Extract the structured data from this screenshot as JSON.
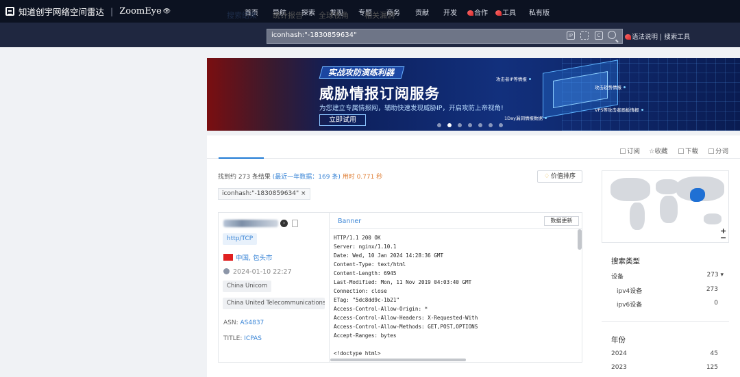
{
  "logo": {
    "cn": "知道创宇网络空间雷达",
    "sep": "|",
    "brand": "ZoomEye",
    "eye": "👁"
  },
  "nav": [
    "首页",
    "导航",
    "探索",
    "发现",
    "专题",
    "商务",
    "贡献",
    "开发",
    "合作",
    "工具",
    "私有版"
  ],
  "search": {
    "query": "iconhash:\"-1830859634\"",
    "icons": [
      "IP",
      "face",
      "C"
    ],
    "link1": "语法说明",
    "sep": "|",
    "link2": "搜索工具"
  },
  "banner": {
    "tag": "实战攻防演练利器",
    "title": "威胁情报订阅服务",
    "subtitle": "为您建立专属情报网，辅助快速发现威胁IP，开启攻防上帝视角!",
    "button": "立即试用",
    "labels": [
      "攻击者IP等情报",
      "攻击趋势情报",
      "VPS等攻击者画板情报",
      "1Day漏洞情报数据"
    ],
    "dot_count": 7,
    "active_dot": 1
  },
  "tabs": [
    "搜索结果",
    "统计报告",
    "全球视角",
    "相关漏洞"
  ],
  "actions": [
    "订阅",
    "收藏",
    "下载",
    "分词"
  ],
  "summary": {
    "prefix": "找到约 273 条结果",
    "recent": "(最近一年数据：169 条)",
    "time": "用时 0.771 秒"
  },
  "sort_button": "价值排序",
  "query_tag": "iconhash:\"-1830859634\"  ×",
  "result": {
    "go": "›",
    "protocol": "http/TCP",
    "location": "中国, 包头市",
    "time": "2024-01-10 22:27",
    "org1": "China Unicom",
    "org2": "China United Telecommunications Co...",
    "asn_label": "ASN: ",
    "asn": "AS4837",
    "title_label": "TITLE: ",
    "title": "ICPAS",
    "banner_label": "Banner",
    "update_button": "数据更新",
    "http": "HTTP/1.1 200 OK\nServer: nginx/1.10.1\nDate: Wed, 10 Jan 2024 14:28:36 GMT\nContent-Type: text/html\nContent-Length: 6945\nLast-Modified: Mon, 11 Nov 2019 04:03:40 GMT\nConnection: close\nETag: \"5dc8dd9c-1b21\"\nAccess-Control-Allow-Origin: *\nAccess-Control-Allow-Headers: X-Requested-With\nAccess-Control-Allow-Methods: GET,POST,OPTIONS\nAccept-Ranges: bytes\n\n<!doctype html>"
  },
  "map": {
    "plus": "+",
    "minus": "−"
  },
  "sidebar": {
    "search_type_title": "搜索类型",
    "rows": [
      {
        "label": "设备",
        "value": "273 ▾"
      },
      {
        "label": "ipv4设备",
        "value": "273"
      },
      {
        "label": "ipv6设备",
        "value": "0"
      }
    ],
    "year_title": "年份",
    "years": [
      {
        "label": "2024",
        "value": "45"
      },
      {
        "label": "2023",
        "value": "125"
      }
    ]
  }
}
